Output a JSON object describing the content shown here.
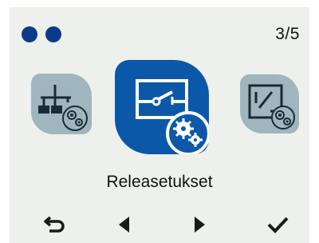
{
  "header": {
    "page_indicator": "3/5",
    "status_dots": [
      "status-dot",
      "status-dot"
    ]
  },
  "carousel": {
    "items": [
      {
        "icon": "network-settings-icon"
      },
      {
        "icon": "relay-settings-icon",
        "label": "Releasetukset",
        "selected": true
      },
      {
        "icon": "analog-output-settings-icon"
      }
    ]
  },
  "nav": {
    "buttons": [
      {
        "icon": "back-icon"
      },
      {
        "icon": "previous-icon"
      },
      {
        "icon": "next-icon"
      },
      {
        "icon": "confirm-icon"
      }
    ]
  },
  "colors": {
    "background": "#eef0ed",
    "accent": "#0b58a9",
    "dot": "#0b3a8c",
    "inactive_tile": "#9fb6bf",
    "icon_dark": "#1a2b33"
  }
}
